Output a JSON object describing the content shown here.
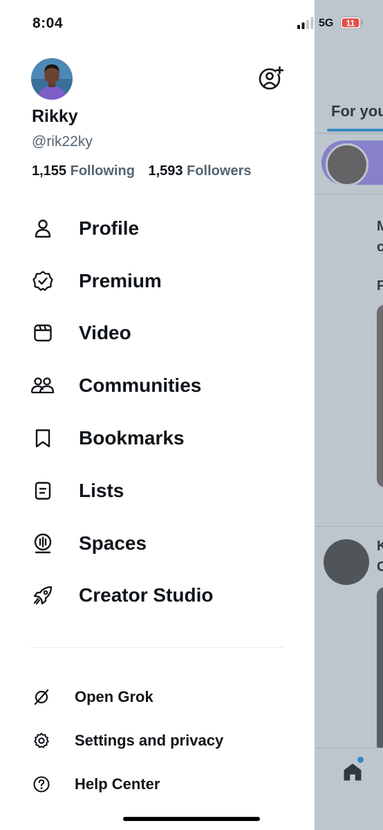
{
  "status_bar": {
    "time": "8:04",
    "network": "5G",
    "battery": "11"
  },
  "profile": {
    "display_name": "Rikky",
    "handle": "@rik22ky",
    "following_count": "1,155",
    "following_label": "Following",
    "followers_count": "1,593",
    "followers_label": "Followers"
  },
  "menu": {
    "items": [
      {
        "label": "Profile",
        "icon": "person-icon"
      },
      {
        "label": "Premium",
        "icon": "verified-badge-icon"
      },
      {
        "label": "Video",
        "icon": "video-icon"
      },
      {
        "label": "Communities",
        "icon": "communities-icon"
      },
      {
        "label": "Bookmarks",
        "icon": "bookmark-icon"
      },
      {
        "label": "Lists",
        "icon": "list-icon"
      },
      {
        "label": "Spaces",
        "icon": "spaces-icon"
      },
      {
        "label": "Creator Studio",
        "icon": "rocket-icon"
      }
    ]
  },
  "sub_menu": {
    "items": [
      {
        "label": "Open Grok",
        "icon": "grok-icon"
      },
      {
        "label": "Settings and privacy",
        "icon": "gear-icon"
      },
      {
        "label": "Help Center",
        "icon": "help-icon"
      }
    ]
  },
  "timeline": {
    "tab_label": "For you",
    "text_1": "M",
    "text_2": "c",
    "text_3": "P",
    "text_4": "K",
    "text_5": "C"
  },
  "colors": {
    "accent": "#1d9bf0",
    "text_primary": "#0f1419",
    "text_secondary": "#536471",
    "battery_low": "#e0524b",
    "story_ring": "#a78bfa"
  }
}
